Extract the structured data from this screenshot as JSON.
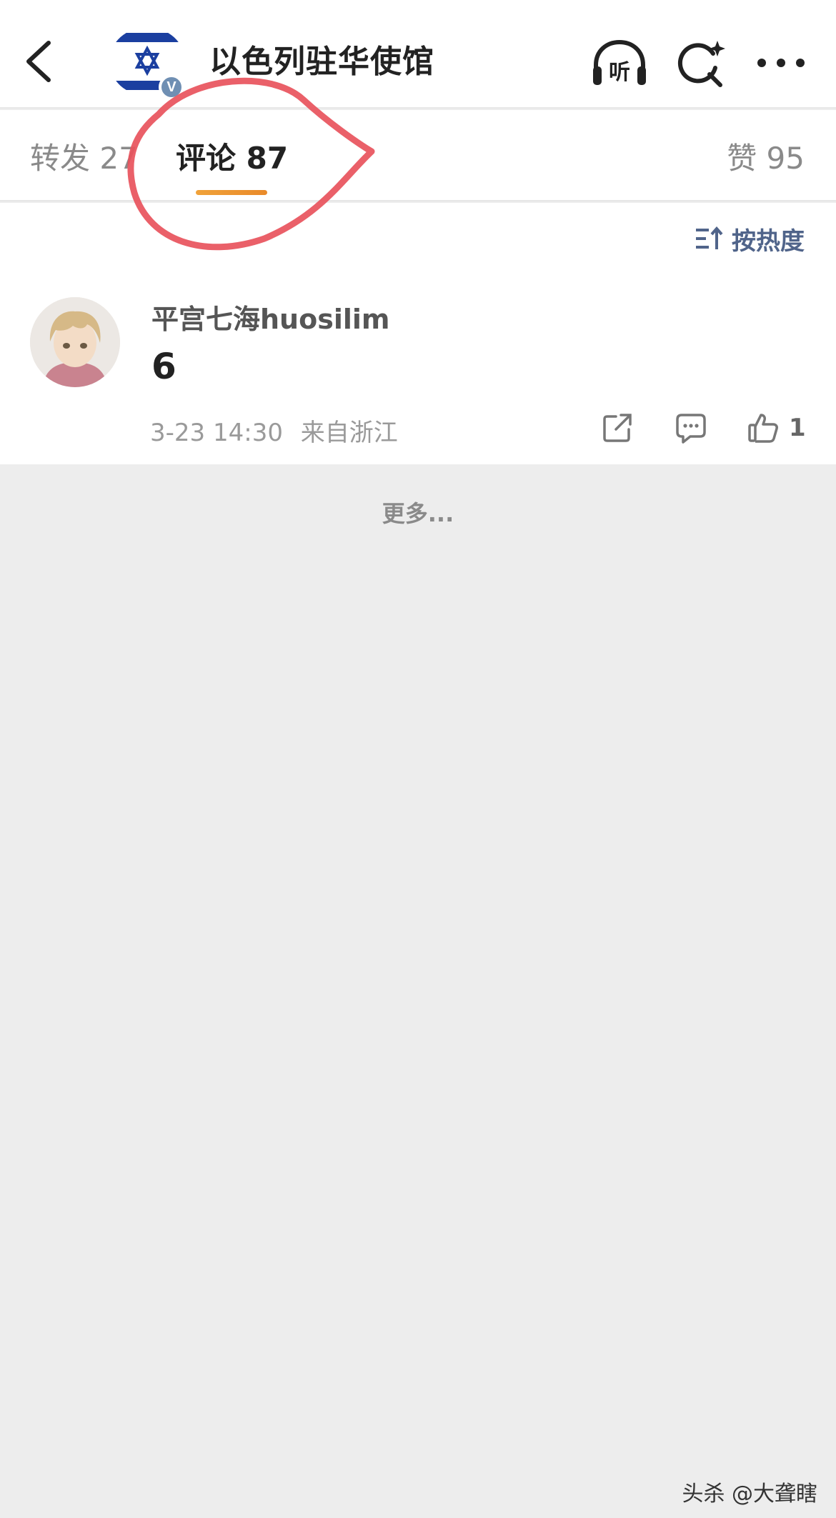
{
  "header": {
    "title": "以色列驻华使馆",
    "verified_badge": "V",
    "listen_label": "听"
  },
  "tabs": {
    "repost": "转发 27",
    "comments": "评论 87",
    "likes": "赞 95"
  },
  "sort": {
    "label": "按热度"
  },
  "comments": [
    {
      "username": "平宫七海huosilim",
      "text": "6",
      "time": "3-23 14:30",
      "location": "来自浙江",
      "likes": "1"
    }
  ],
  "more_label": "更多...",
  "watermark": "头杀 @大聋瞎",
  "colors": {
    "accent_underline": "#eb922e",
    "annotation": "#e8525c",
    "sort_text": "#50648a"
  },
  "icons": [
    "back-chevron-icon",
    "israel-flag-avatar",
    "headphones-icon",
    "search-sparkle-icon",
    "more-dots-icon",
    "sort-icon",
    "share-icon",
    "reply-icon",
    "thumbs-up-icon"
  ]
}
